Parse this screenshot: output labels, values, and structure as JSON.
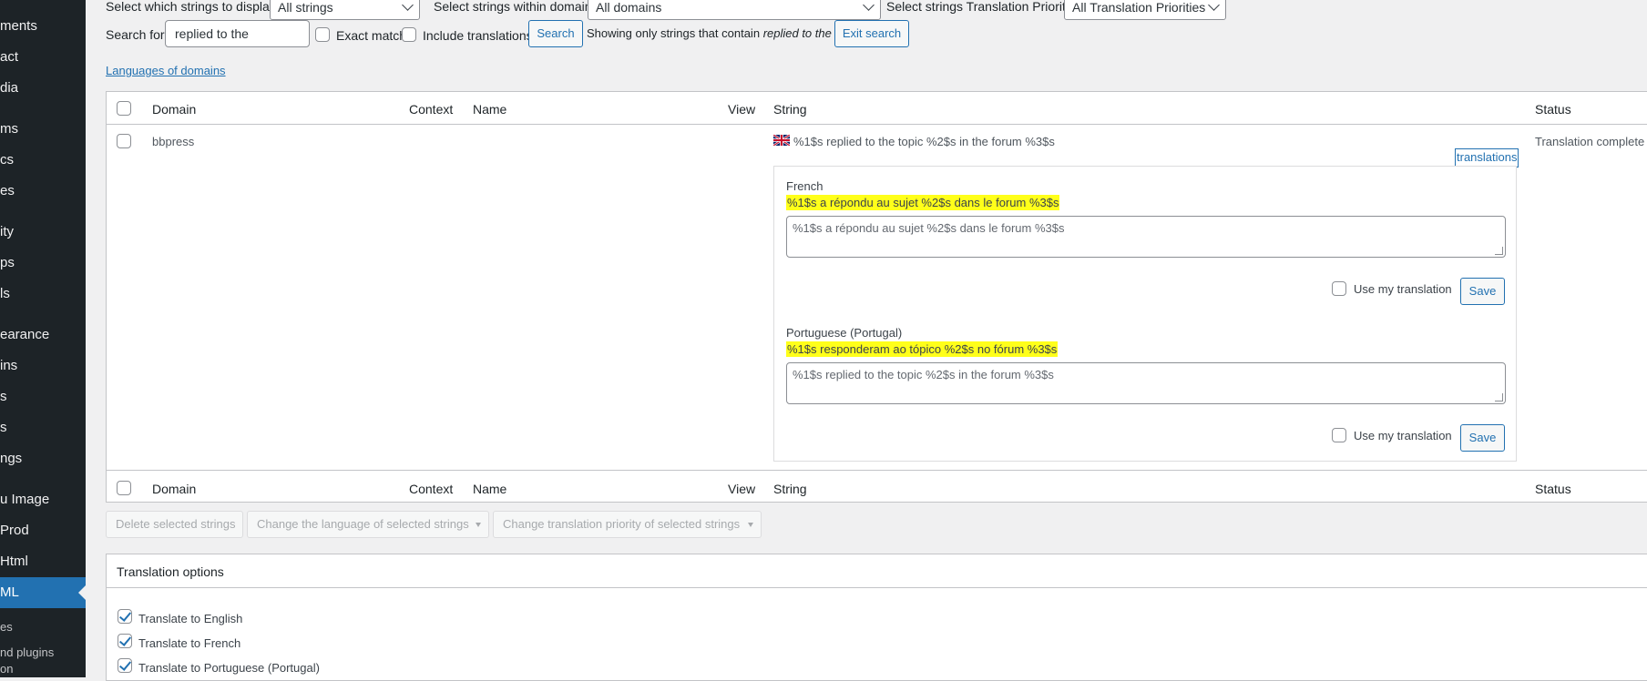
{
  "sidebar": {
    "items": [
      {
        "label": "ments"
      },
      {
        "label": "act"
      },
      {
        "label": "dia"
      },
      {
        "label": "ms"
      },
      {
        "label": "cs"
      },
      {
        "label": "es"
      },
      {
        "label": "ity"
      },
      {
        "label": "ps"
      },
      {
        "label": "ls"
      },
      {
        "label": "earance"
      },
      {
        "label": "ins"
      },
      {
        "label": "s"
      },
      {
        "label": "s"
      },
      {
        "label": "ngs"
      },
      {
        "label": "u Image"
      },
      {
        "label": "Prod"
      },
      {
        "label": "Html"
      },
      {
        "label": "ML"
      }
    ],
    "sub_items": [
      "es",
      "nd plugins",
      "on"
    ]
  },
  "filters": {
    "display_label": "Select which strings to display:",
    "display_value": "All strings",
    "domain_label": "Select strings within domain:",
    "domain_value": "All domains",
    "priority_label": "Select strings Translation Priority:",
    "priority_value": "All Translation Priorities",
    "search_label": "Search for:",
    "search_value": "replied to the",
    "exact_match_label": "Exact match",
    "include_translations_label": "Include translations",
    "search_button": "Search",
    "showing_prefix": "Showing only strings that contain",
    "showing_term": "replied to the",
    "exit_search_button": "Exit search",
    "languages_link": "Languages of domains"
  },
  "table": {
    "headers": {
      "domain": "Domain",
      "context": "Context",
      "name": "Name",
      "view": "View",
      "string": "String",
      "status": "Status"
    },
    "row": {
      "domain": "bbpress",
      "string": "%1$s replied to the topic %2$s in the forum %3$s",
      "status": "Translation complete",
      "translations_button": "translations",
      "flag_icon": "uk-flag-icon"
    },
    "translations": [
      {
        "language": "French",
        "current": "%1$s a répondu au sujet %2$s dans le forum %3$s",
        "textarea": "%1$s a répondu au sujet %2$s dans le forum %3$s",
        "use_mine_label": "Use my translation",
        "save_label": "Save"
      },
      {
        "language": "Portuguese (Portugal)",
        "current": "%1$s responderam ao tópico %2$s no fórum %3$s",
        "textarea": "%1$s replied to the topic %2$s in the forum %3$s",
        "use_mine_label": "Use my translation",
        "save_label": "Save"
      }
    ]
  },
  "bulk_actions": {
    "delete": "Delete selected strings",
    "change_language": "Change the language of selected strings",
    "change_priority": "Change translation priority of selected strings"
  },
  "translation_options": {
    "title": "Translation options",
    "options": [
      {
        "label": "Translate to English",
        "checked": true
      },
      {
        "label": "Translate to French",
        "checked": true
      },
      {
        "label": "Translate to Portuguese (Portugal)",
        "checked": true
      }
    ]
  },
  "colors": {
    "sidebar_bg": "#1d2327",
    "accent": "#2271b1",
    "highlight": "#ffff1a"
  }
}
